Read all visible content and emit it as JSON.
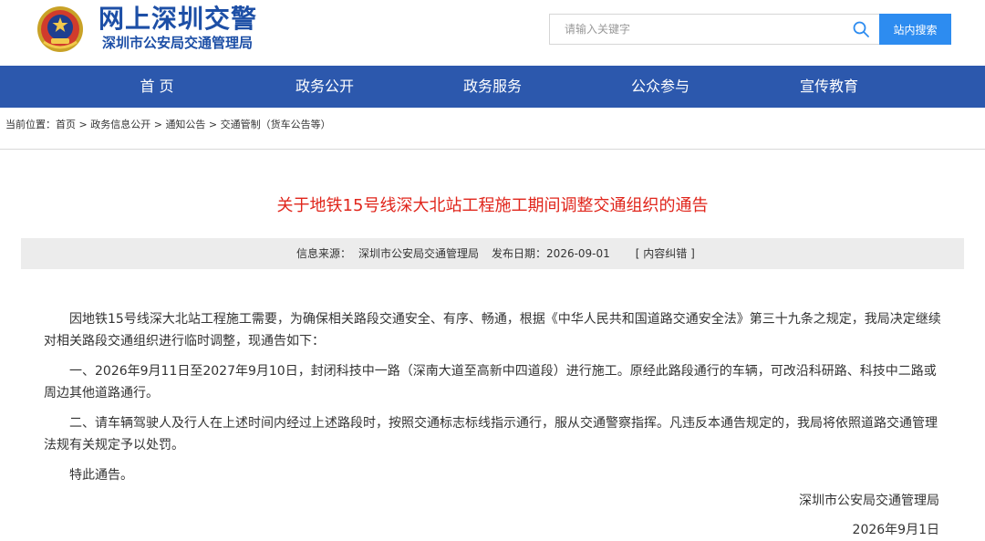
{
  "header": {
    "site_title": "网上深圳交警",
    "site_subtitle": "深圳市公安局交通管理局",
    "emblem_icon": "police-emblem-icon",
    "search": {
      "placeholder": "请输入关键字",
      "button_label": "站内搜索"
    }
  },
  "nav": {
    "items": [
      {
        "label": "首 页"
      },
      {
        "label": "政务公开"
      },
      {
        "label": "政务服务"
      },
      {
        "label": "公众参与"
      },
      {
        "label": "宣传教育"
      }
    ]
  },
  "breadcrumb": {
    "prefix": "当前位置：",
    "items": [
      "首页",
      "政务信息公开",
      "通知公告",
      "交通管制（货车公告等）"
    ],
    "separator": " > "
  },
  "article": {
    "title": "关于地铁15号线深大北站工程施工期间调整交通组织的通告",
    "meta": {
      "source_label": "信息来源：",
      "source": "深圳市公安局交通管理局",
      "date_label": "发布日期：",
      "date": "2026-09-01",
      "correction": "[ 内容纠错 ]"
    },
    "paragraphs": [
      "因地铁15号线深大北站工程施工需要，为确保相关路段交通安全、有序、畅通，根据《中华人民共和国道路交通安全法》第三十九条之规定，我局决定继续对相关路段交通组织进行临时调整，现通告如下：",
      "一、2026年9月11日至2027年9月10日，封闭科技中一路（深南大道至高新中四道段）进行施工。原经此路段通行的车辆，可改沿科研路、科技中二路或周边其他道路通行。",
      "二、请车辆驾驶人及行人在上述时间内经过上述路段时，按照交通标志标线指示通行，服从交通警察指挥。凡违反本通告规定的，我局将依照道路交通管理法规有关规定予以处罚。",
      "特此通告。"
    ],
    "signature": {
      "org": "深圳市公安局交通管理局",
      "date": "2026年9月1日"
    }
  },
  "colors": {
    "brand_blue": "#1d4fa6",
    "nav_bg": "#2c58ad",
    "search_button": "#2d8cf0",
    "title_red": "#e0251b",
    "meta_bg": "#ececec"
  }
}
